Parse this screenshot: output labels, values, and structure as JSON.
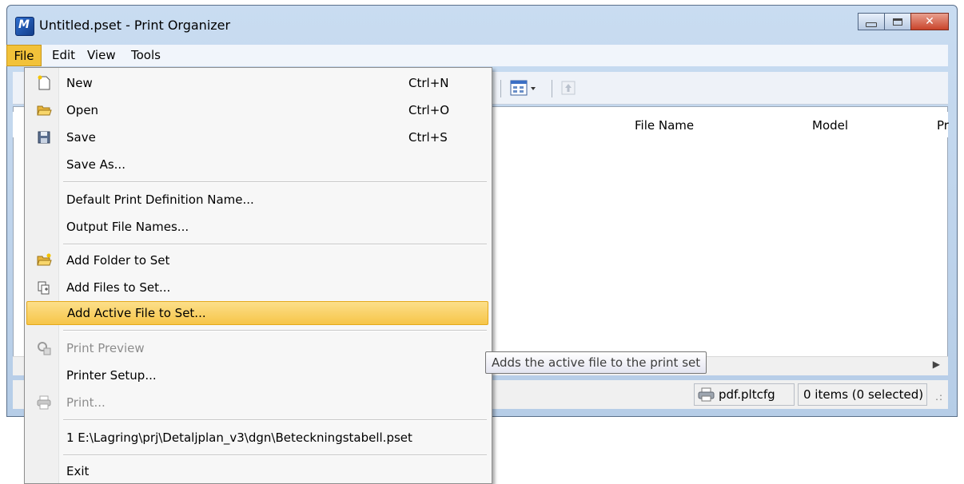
{
  "window": {
    "title": "Untitled.pset - Print Organizer",
    "app_icon": "microstation-logo",
    "app_icon_letter": "M",
    "close_glyph": "✕"
  },
  "menubar": {
    "items": [
      "File",
      "Edit",
      "View",
      "Tools"
    ]
  },
  "list": {
    "columns": [
      "File Name",
      "Model",
      "Pr"
    ]
  },
  "file_menu": {
    "items": [
      {
        "label": "New",
        "shortcut": "Ctrl+N",
        "icon": "new-document-icon"
      },
      {
        "label": "Open",
        "shortcut": "Ctrl+O",
        "icon": "open-folder-icon"
      },
      {
        "label": "Save",
        "shortcut": "Ctrl+S",
        "icon": "floppy-disk-icon"
      },
      {
        "label": "Save As...",
        "shortcut": ""
      },
      {
        "label": "Default Print Definition Name...",
        "shortcut": ""
      },
      {
        "label": "Output File Names...",
        "shortcut": ""
      },
      {
        "label": "Add Folder to Set",
        "icon": "folder-icon"
      },
      {
        "label": "Add Files to Set...",
        "icon": "add-files-icon"
      },
      {
        "label": "Add Active File to Set...",
        "highlighted": true
      },
      {
        "label": "Print Preview",
        "disabled": true,
        "icon": "print-preview-icon"
      },
      {
        "label": "Printer Setup..."
      },
      {
        "label": "Print...",
        "disabled": true,
        "icon": "printer-icon"
      },
      {
        "label": "1 E:\\Lagring\\prj\\Detaljplan_v3\\dgn\\Beteckningstabell.pset"
      },
      {
        "label": "Exit"
      }
    ]
  },
  "tooltip": {
    "text": "Adds the active file to the print set"
  },
  "statusbar": {
    "printer": "pdf.pltcfg",
    "items": "0 items (0 selected)"
  },
  "colors": {
    "highlight": "#f6c549",
    "title_bg": "#c9dcf1",
    "close_button": "#c9442b"
  }
}
